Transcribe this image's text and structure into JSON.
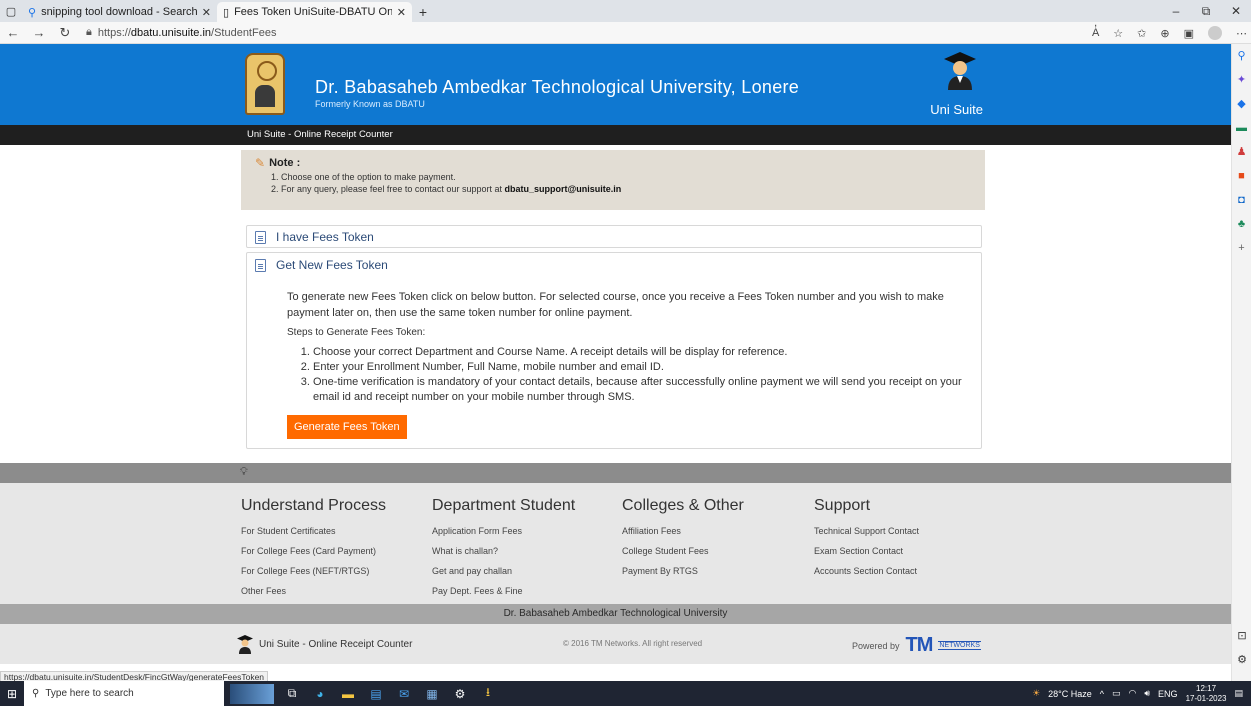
{
  "browser": {
    "tabs": [
      {
        "label": "snipping tool download - Search",
        "active": false
      },
      {
        "label": "Fees Token UniSuite-DBATU Onli",
        "active": true
      }
    ],
    "url_prefix": "https://",
    "url_domain": "dbatu.unisuite.in",
    "url_path": "/StudentFees",
    "status_url": "https://dbatu.unisuite.in/StudentDesk/FincGtWay/generateFeesToken"
  },
  "header": {
    "university": "Dr. Babasaheb Ambedkar Technological University, Lonere",
    "formerly": "Formerly Known as DBATU",
    "brand": "Uni Suite",
    "subbar": "Uni Suite - Online Receipt Counter"
  },
  "note": {
    "heading": "Note :",
    "line1": "1. Choose one of the option to make payment.",
    "line2_prefix": "2. For any query, please feel free to contact our support at ",
    "line2_email": "dbatu_support@unisuite.in"
  },
  "panels": {
    "have_token": "I have Fees Token",
    "new_token": "Get New Fees Token",
    "intro": "To generate new Fees Token click on below button. For selected course, once you receive a Fees Token number and you wish to make payment later on, then use the same token number for online payment.",
    "steps_heading": "Steps to Generate Fees Token:",
    "steps": [
      "Choose your correct Department and Course Name. A receipt details will be display for reference.",
      "Enter your Enrollment Number, Full Name, mobile number and email ID.",
      "One-time verification is mandatory of your contact details, because after successfully online payment we will send you receipt on your email id and receipt number on your mobile number through SMS."
    ],
    "button": "Generate Fees Token"
  },
  "footer": {
    "columns": [
      {
        "heading": "Understand Process",
        "items": [
          "For Student Certificates",
          "For College Fees (Card Payment)",
          "For College Fees (NEFT/RTGS)",
          "Other Fees"
        ]
      },
      {
        "heading": "Department Student",
        "items": [
          "Application Form Fees",
          "What is challan?",
          "Get and pay challan",
          "Pay Dept. Fees & Fine"
        ]
      },
      {
        "heading": "Colleges & Other",
        "items": [
          "Affiliation Fees",
          "College Student Fees",
          "Payment By RTGS"
        ]
      },
      {
        "heading": "Support",
        "items": [
          "Technical Support Contact",
          "Exam Section Contact",
          "Accounts Section Contact"
        ]
      }
    ],
    "bar_text": "Dr. Babasaheb Ambedkar Technological University",
    "bottom_left": "Uni Suite - Online Receipt Counter",
    "copyright": "© 2016 TM Networks. All right reserved",
    "powered_by": "Powered by",
    "tm_logo": "TM",
    "tm_networks": "NETWORKS"
  },
  "taskbar": {
    "search_placeholder": "Type here to search",
    "weather": "28°C  Haze",
    "lang": "ENG",
    "time": "12:17",
    "date": "17-01-2023"
  }
}
